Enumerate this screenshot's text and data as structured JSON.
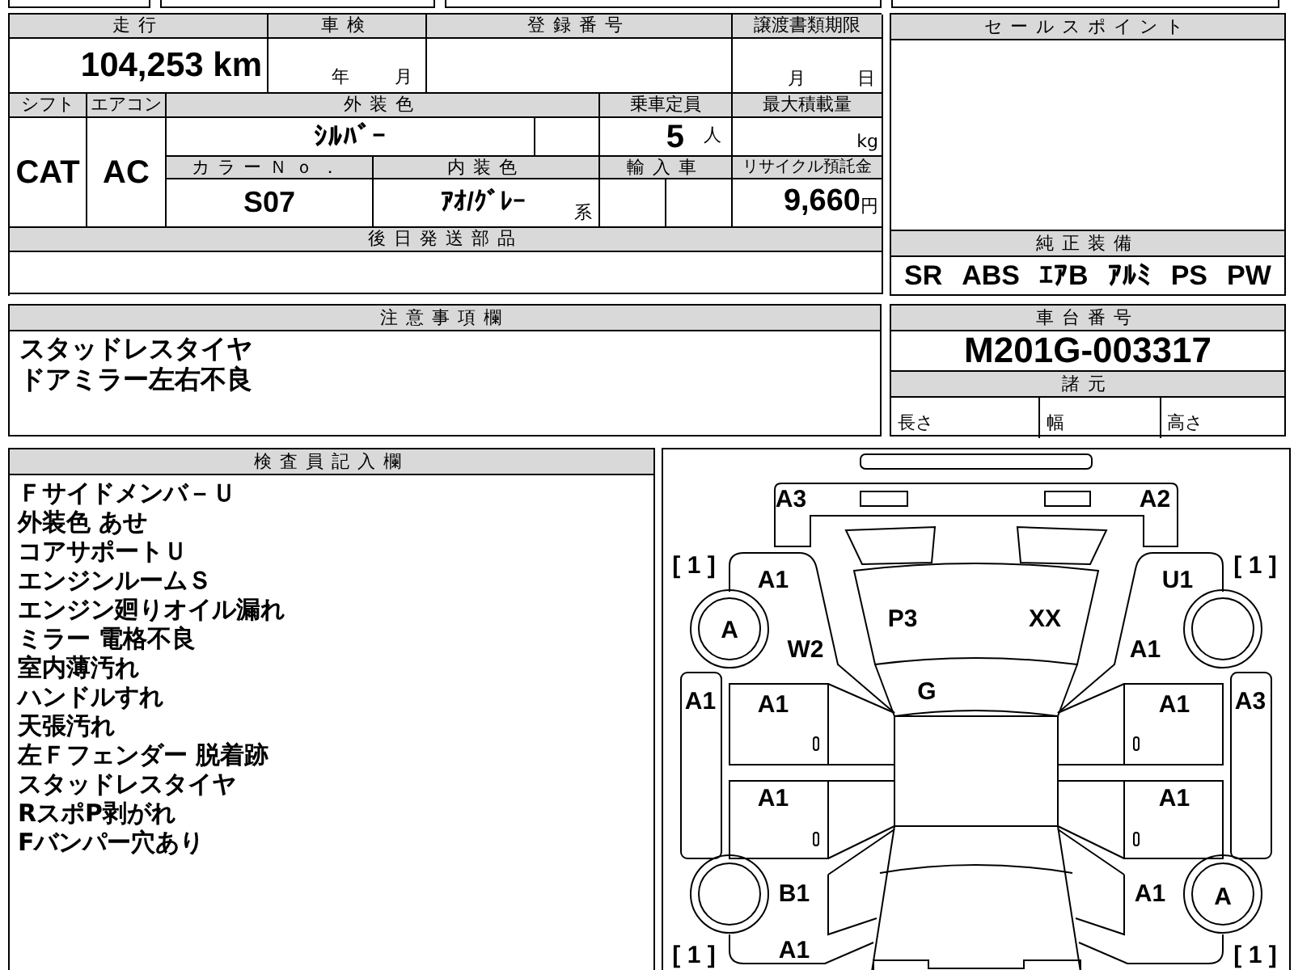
{
  "vehicle_form": {
    "mileage": {
      "label": "走行",
      "value": "104,253 km"
    },
    "inspection": {
      "label": "車検",
      "year_unit": "年",
      "month_unit": "月"
    },
    "registration_number": {
      "label": "登録番号"
    },
    "transfer_deadline": {
      "label": "譲渡書類期限",
      "month_unit": "月",
      "day_unit": "日"
    },
    "shift": {
      "label": "シフト",
      "value": "CAT"
    },
    "air_conditioning": {
      "label": "エアコン",
      "value": "AC"
    },
    "exterior_color": {
      "label": "外装色",
      "value": "ｼﾙﾊﾞｰ"
    },
    "capacity": {
      "label": "乗車定員",
      "value": "5",
      "unit": "人"
    },
    "max_load": {
      "label": "最大積載量",
      "unit": "kg"
    },
    "color_number": {
      "label": "カラーＮｏ．",
      "value": "S07"
    },
    "interior_color": {
      "label": "内装色",
      "value": "ｱｵ/ｸﾞﾚｰ",
      "unit": "系"
    },
    "imported": {
      "label": "輸入車"
    },
    "recycling_fee": {
      "label": "リサイクル預託金",
      "value": "9,660",
      "unit": "円"
    },
    "parts_to_follow": {
      "label": "後日発送部品"
    }
  },
  "sales_points": {
    "label": "セールスポイント"
  },
  "standard_equipment": {
    "label": "純正装備",
    "items": [
      "SR",
      "ABS",
      "ｴｱB",
      "ｱﾙﾐ",
      "PS",
      "PW"
    ]
  },
  "notes": {
    "label": "注意事項欄",
    "lines": [
      "スタッドレスタイヤ",
      "ドアミラー左右不良"
    ]
  },
  "chassis": {
    "label": "車台番号",
    "value": "M201G-003317"
  },
  "specs": {
    "label": "諸元",
    "cells": [
      "長さ",
      "幅",
      "高さ"
    ]
  },
  "inspector_remarks": {
    "label": "検査員記入欄",
    "lines": [
      "Ｆサイドメンバ－Ｕ",
      "外装色 あせ",
      "コアサポートＵ",
      "エンジンルームＳ",
      "エンジン廻りオイル漏れ",
      "ミラー 電格不良",
      "室内薄汚れ",
      "ハンドルすれ",
      "天張汚れ",
      "左Ｆフェンダー 脱着跡",
      "スタッドレスタイヤ",
      "RスポP剥がれ",
      "Fバンパー穴あり"
    ]
  },
  "damage_diagram": {
    "marks": {
      "front_bumper_left": "A3",
      "front_bumper_right": "A2",
      "tread_front_left": "[ 1 ]",
      "front_fender_left": "A1",
      "front_fender_right": "U1",
      "tread_front_right": "[ 1 ]",
      "hood_left": "P3",
      "hood_right": "XX",
      "wheel_front_left": "A",
      "pillar_left": "W2",
      "pillar_right": "A1",
      "windshield": "G",
      "step_left": "A1",
      "front_door_left": "A1",
      "front_door_right": "A1",
      "step_right": "A3",
      "rear_door_left": "A1",
      "rear_door_right": "A1",
      "rear_fender_left": "B1",
      "rear_fender_right": "A1",
      "wheel_rear_right": "A",
      "tread_rear_left": "[ 1 ]",
      "rear_quarter_left": "A1",
      "tread_rear_right": "[ 1 ]"
    }
  }
}
